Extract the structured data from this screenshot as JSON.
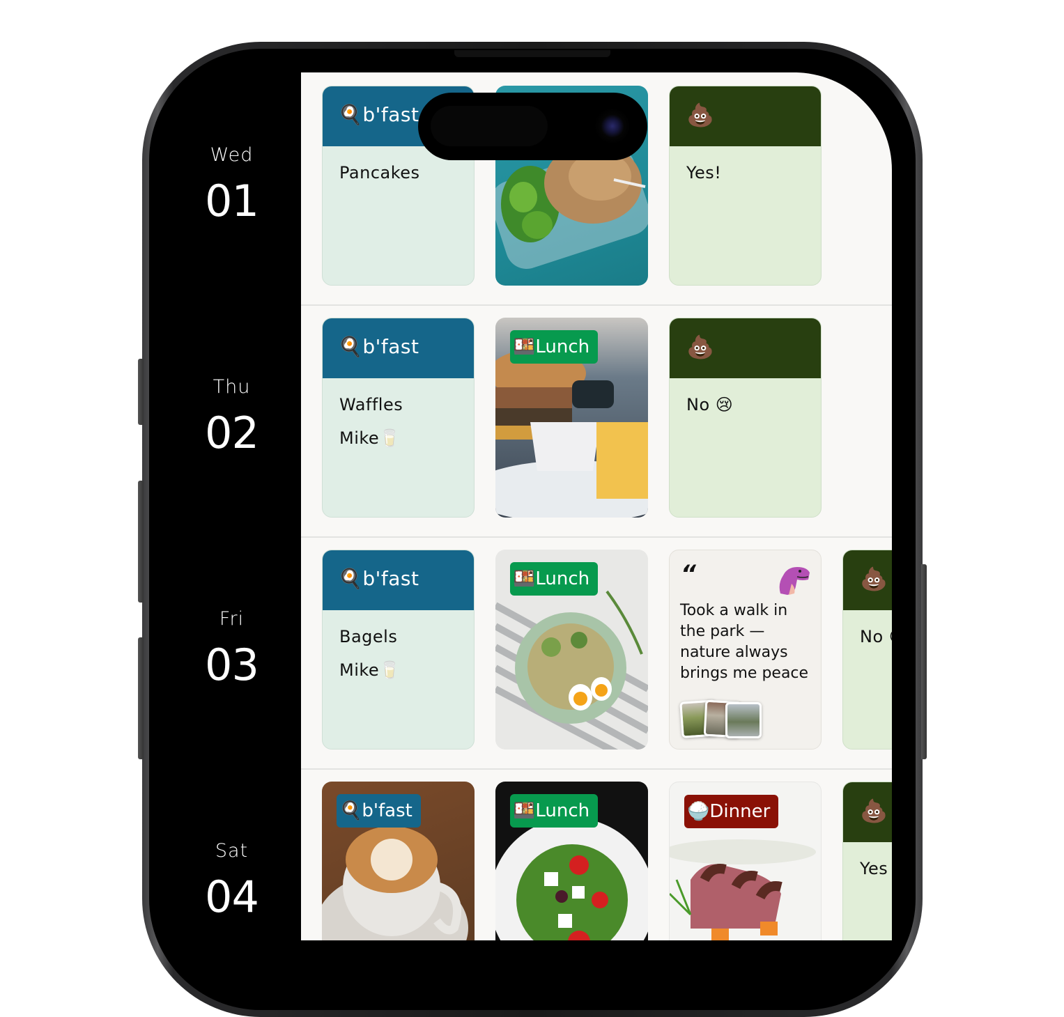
{
  "days": [
    {
      "weekday": "Wed",
      "date": "01"
    },
    {
      "weekday": "Thu",
      "date": "02"
    },
    {
      "weekday": "Fri",
      "date": "03"
    },
    {
      "weekday": "Sat",
      "date": "04"
    }
  ],
  "meal_labels": {
    "breakfast": "b'fast",
    "lunch": "Lunch",
    "dinner": "Dinner"
  },
  "icons": {
    "breakfast": "🍳",
    "lunch": "🍱",
    "dinner": "🍚",
    "poop": "💩",
    "milk": "🥛",
    "crying": "😢",
    "quote": "“"
  },
  "rows": [
    {
      "breakfast_lines": [
        "Pancakes"
      ],
      "lunch_photo": "chicken-broccoli-meal-prep",
      "poop_answer": "Yes!"
    },
    {
      "breakfast_lines": [
        "Waffles",
        "Mike🥛"
      ],
      "lunch_photo": "burger-and-fries",
      "poop_answer": "No 😢"
    },
    {
      "breakfast_lines": [
        "Bagels",
        "Mike🥛"
      ],
      "lunch_photo": "rice-bowl-with-eggs",
      "note": "Took a walk in the park — nature always brings me peace",
      "poop_answer": "No 😢"
    },
    {
      "breakfast_photo": "latte-art",
      "lunch_photo": "greek-salad",
      "dinner_photo": "sliced-duck-breast",
      "poop_answer": "Yes"
    }
  ],
  "colors": {
    "breakfast": "#15668a",
    "lunch": "#079a4e",
    "dinner": "#8a1106",
    "poop_header": "#283f10",
    "text_card_bg": "#e0eee6",
    "poop_card_bg": "#e1eed8",
    "note_card_bg": "#f3f1ed",
    "content_bg": "#f9f8f6"
  }
}
